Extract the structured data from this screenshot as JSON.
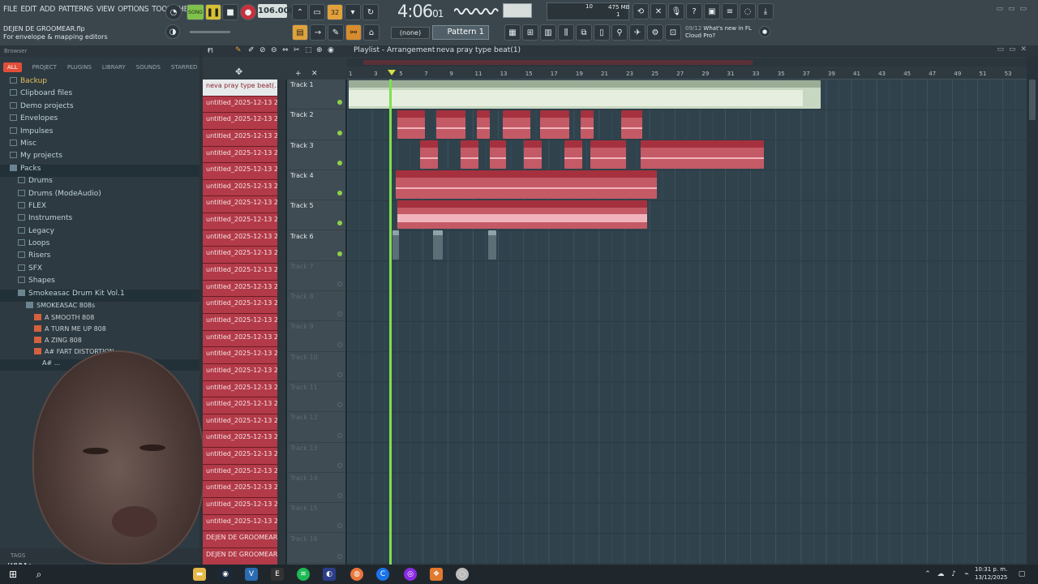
{
  "menu": [
    "FILE",
    "EDIT",
    "ADD",
    "PATTERNS",
    "VIEW",
    "OPTIONS",
    "TOOLS",
    "HELP"
  ],
  "project": {
    "file": "DEJEN DE GROOMEAR.flp",
    "hint": "For envelope & mapping editors"
  },
  "transport": {
    "mode": "SONG",
    "tempo": "106.000",
    "time_main": "4:06",
    "time_sub": "01",
    "pattern_mode_label": "32"
  },
  "memory": {
    "value": "475 MB",
    "cpu": "10",
    "voices": "1"
  },
  "pattern": {
    "snap": "(none)",
    "name": "Pattern 1"
  },
  "news": {
    "date": "09/12",
    "text_1": "What's new in FL",
    "text_2": "Cloud Pro?"
  },
  "browser": {
    "title": "Browser",
    "tabs": [
      "ALL",
      "PROJECT",
      "PLUGINS",
      "LIBRARY",
      "SOUNDS",
      "STARRED"
    ],
    "folders": [
      "Backup",
      "Clipboard files",
      "Demo projects",
      "Envelopes",
      "Impulses",
      "Misc",
      "My projects",
      "Packs"
    ],
    "packs": [
      "Drums",
      "Drums (ModeAudio)",
      "FLEX",
      "Instruments",
      "Legacy",
      "Loops",
      "Risers",
      "SFX",
      "Shapes",
      "Smokeasac Drum Kit Vol.1"
    ],
    "subfolder": "SMOKEASAC 808s",
    "samples": [
      "A SMOOTH 808",
      "A TURN ME UP 808",
      "A ZING 808",
      "A# FART DISTORTION",
      "A# ..."
    ],
    "tags": "TAGS"
  },
  "playlist": {
    "title": "Playlist - Arrangement",
    "pattern": "neva pray type beat(1)",
    "ruler": [
      "1",
      "3",
      "5",
      "7",
      "9",
      "11",
      "13",
      "15",
      "17",
      "19",
      "21",
      "23",
      "25",
      "27",
      "29",
      "31",
      "33",
      "35",
      "37",
      "39",
      "41",
      "43",
      "45",
      "47",
      "49",
      "51",
      "53"
    ],
    "tracks": [
      "Track 1",
      "Track 2",
      "Track 3",
      "Track 4",
      "Track 5",
      "Track 6",
      "Track 7",
      "Track 8",
      "Track 9",
      "Track 10",
      "Track 11",
      "Track 12",
      "Track 13",
      "Track 14",
      "Track 15",
      "Track 16"
    ],
    "clip_labels": {
      "beat": "neva pray type beat(1)",
      "t2": [
        "unti..ec",
        "unti..rec",
        "unti..ec",
        "unti..rec",
        "un..c"
      ],
      "t3": [
        "untit..._rec",
        "untitled_2025-12-13 21-46-40_rec"
      ],
      "t4": "DEJEN DE GROOMEAR_2025-12-13 22-13-06_rec",
      "t5": "DEJEN DE GROOMEAR_2025-12-13 22-14-36_rec"
    }
  },
  "channels": {
    "first": "neva pray type beat(...",
    "items": [
      "untitled_2025-12-13 21-...",
      "untitled_2025-12-13 21-...",
      "untitled_2025-12-13 21-...",
      "untitled_2025-12-13 21-...",
      "untitled_2025-12-13 21-...",
      "untitled_2025-12-13 21-...",
      "untitled_2025-12-13 21-...",
      "untitled_2025-12-13 21-...",
      "untitled_2025-12-13 21-...",
      "untitled_2025-12-13 21-...",
      "untitled_2025-12-13 21-...",
      "untitled_2025-12-13 21-...",
      "untitled_2025-12-13 21-...",
      "untitled_2025-12-13 21-...",
      "untitled_2025-12-13 21-...",
      "untitled_2025-12-13 21-...",
      "untitled_2025-12-13 21-...",
      "untitled_2025-12-13 21-...",
      "untitled_2025-12-13 21-...",
      "untitled_2025-12-13 21-...",
      "untitled_2025-12-13 21-...",
      "untitled_2025-12-13 21-...",
      "untitled_2025-12-13 21-...",
      "untitled_2025-12-13 21-...",
      "untitled_2025-12-13 21-...",
      "untitled_2025-12-13 21-...",
      "DEJEN DE GROOMEAR_20...",
      "DEJEN DE GROOMEAR_20..."
    ]
  },
  "clock": {
    "time": "10:31 p. m.",
    "date": "13/12/2025"
  },
  "colors": {
    "accent": "#e04e38",
    "audio_clip": "#c45a66",
    "beat_clip": "#c7d7c1",
    "playhead": "#7ee04f"
  }
}
